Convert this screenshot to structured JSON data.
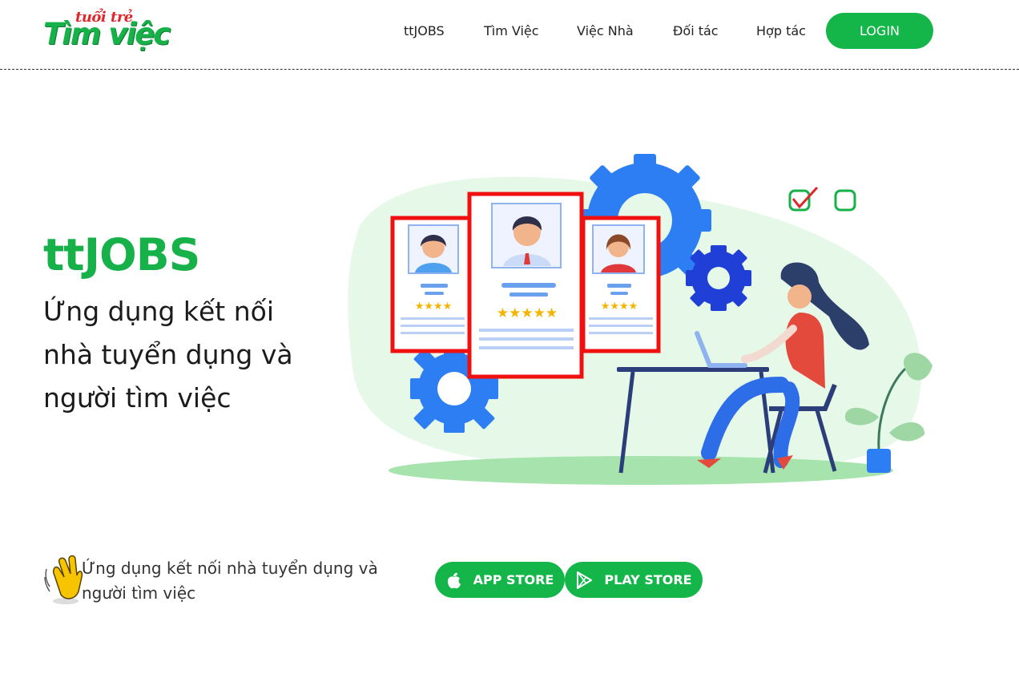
{
  "header": {
    "logo": {
      "top_text": "tuổi trẻ",
      "main_text": "Tìm việc"
    },
    "nav": [
      {
        "label": "ttJOBS"
      },
      {
        "label": "Tìm Việc"
      },
      {
        "label": "Việc Nhà"
      },
      {
        "label": "Đối tác"
      },
      {
        "label": "Hợp tác"
      }
    ],
    "login_label": "LOGIN"
  },
  "hero": {
    "title": "ttJOBS",
    "subtitle": "Ứng dụng kết nối nhà tuyển dụng và người tìm việc"
  },
  "cta": {
    "text": "Ứng dụng kết nối nhà tuyển dụng và người tìm việc",
    "app_store_label": "APP STORE",
    "play_store_label": "PLAY STORE"
  },
  "colors": {
    "brand_green": "#14b64a",
    "logo_red": "#e0262b",
    "gear_blue": "#2d7ef2"
  },
  "icons": [
    "hand-wave-icon",
    "apple-icon",
    "play-store-icon"
  ]
}
